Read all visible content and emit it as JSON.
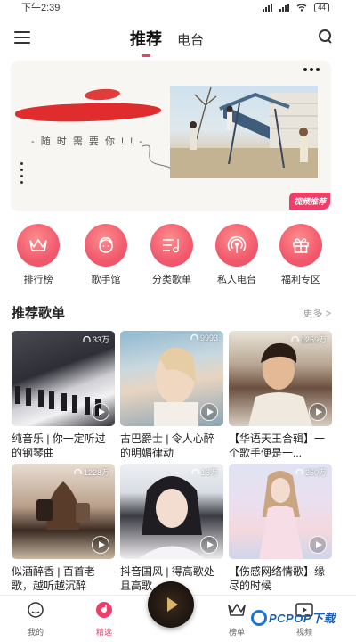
{
  "status": {
    "time": "下午2:39",
    "battery": "44"
  },
  "header": {
    "tabs": [
      {
        "label": "推荐",
        "active": true
      },
      {
        "label": "电台",
        "active": false
      }
    ]
  },
  "banner": {
    "tagline": "- 随 时 需 要 你 ! ! -",
    "badge": "视频推荐"
  },
  "quick_links": [
    {
      "label": "排行榜",
      "icon": "crown-icon"
    },
    {
      "label": "歌手馆",
      "icon": "singer-icon"
    },
    {
      "label": "分类歌单",
      "icon": "playlist-icon"
    },
    {
      "label": "私人电台",
      "icon": "radio-icon"
    },
    {
      "label": "福利专区",
      "icon": "gift-icon"
    }
  ],
  "section": {
    "title": "推荐歌单",
    "more": "更多 >"
  },
  "playlists": [
    {
      "title": "纯音乐 | 你一定听过的钢琴曲",
      "count": "33万"
    },
    {
      "title": "古巴爵士 | 令人心醉的明媚律动",
      "count": "9993"
    },
    {
      "title": "【华语天王合辑】一个歌手便是一...",
      "count": "1259万"
    },
    {
      "title": "似酒醉香 | 百首老歌，越听越沉醉",
      "count": "1228万"
    },
    {
      "title": "抖音国风 | 得高歌处且高歌",
      "count": "13万"
    },
    {
      "title": "【伤感网络情歌】缘尽的时候",
      "count": "250万"
    }
  ],
  "tabbar": [
    {
      "label": "我的",
      "active": false,
      "icon": "face-icon"
    },
    {
      "label": "精选",
      "active": true,
      "icon": "music-disc-icon"
    },
    {
      "label": "榜单",
      "active": false,
      "icon": "crown-icon"
    },
    {
      "label": "视频",
      "active": false,
      "icon": "video-icon"
    }
  ],
  "watermark": {
    "text": "PCPOP下载"
  },
  "colors": {
    "accent": "#ee3f6a",
    "quick_gradient_end": "#ea4863"
  }
}
